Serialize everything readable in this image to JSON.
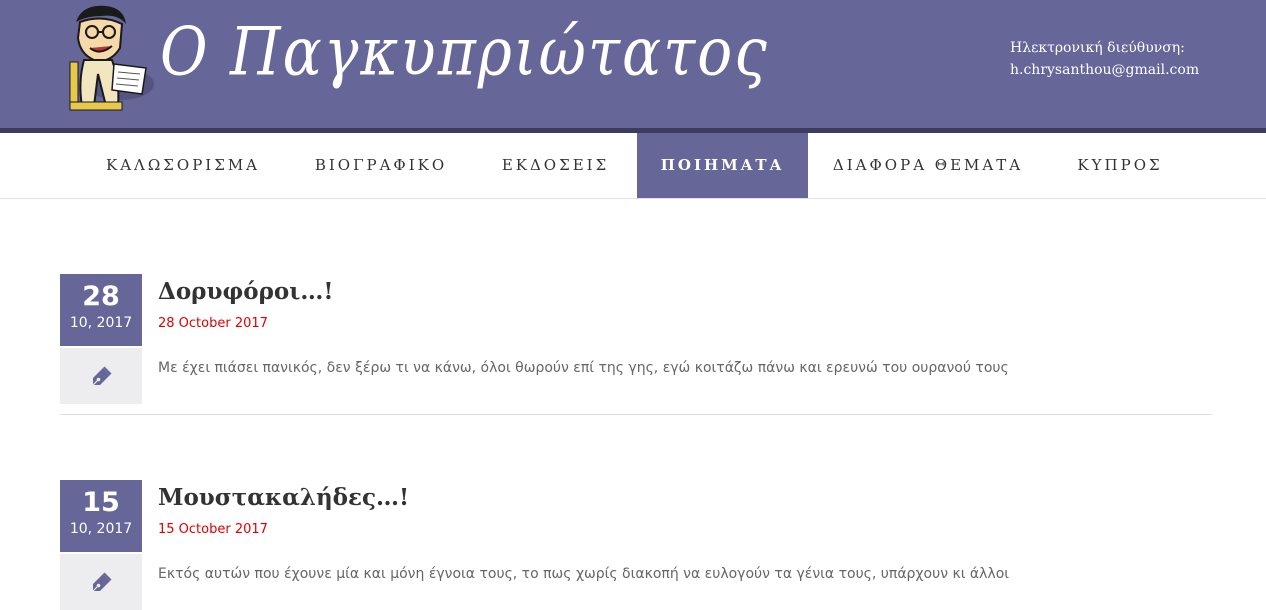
{
  "site": {
    "logo_text": "Ο Παγκυπριώτατος",
    "contact_label": "Ηλεκτρονική διεύθυνση:",
    "contact_email": "h.chrysanthou@gmail.com"
  },
  "nav": {
    "items": [
      {
        "label": "ΚΑΛΩΣΟΡΙΣΜΑ"
      },
      {
        "label": "ΒΙΟΓΡΑΦΙΚΟ"
      },
      {
        "label": "ΕΚΔΟΣΕΙΣ"
      },
      {
        "label": "ΠΟΙΗΜΑΤΑ",
        "active": true
      },
      {
        "label": "ΔΙΑΦΟΡΑ ΘΕΜΑΤΑ"
      },
      {
        "label": "ΚΥΠΡΟΣ"
      }
    ]
  },
  "posts": [
    {
      "day": "28",
      "month_year": "10, 2017",
      "title": "Δορυφόροι…!",
      "date": "28 October 2017",
      "excerpt": "Με έχει πιάσει πανικός, δεν ξέρω τι να κάνω, όλοι θωρούν επί της γης, εγώ κοιτάζω πάνω και ερευνώ του ουρανού τους",
      "icon": "pen-icon"
    },
    {
      "day": "15",
      "month_year": "10, 2017",
      "title": "Μουστακαλήδες…!",
      "date": "15 October 2017",
      "excerpt": " Εκτός αυτών που έχουνε μία και μόνη έγνοια τους,  το πως χωρίς διακοπή να ευλογούν τα γένια τους, υπάρχουν κι άλλοι",
      "icon": "pen-icon"
    }
  ],
  "colors": {
    "brand": "#666699",
    "stripe": "#3d3b5e",
    "date_red": "#e00000"
  }
}
